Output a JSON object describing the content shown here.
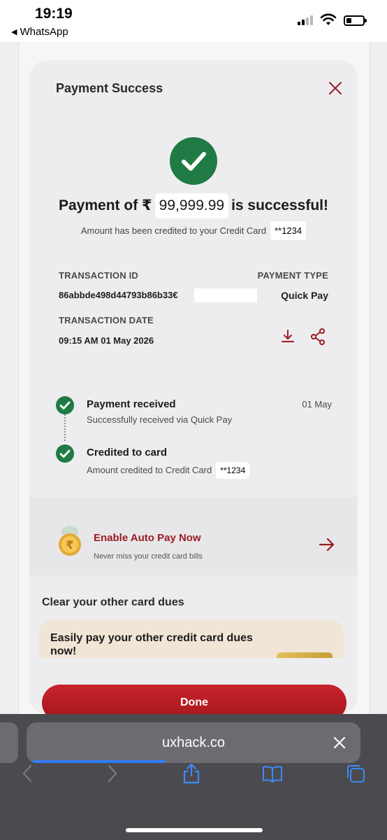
{
  "status_bar": {
    "time": "19:19",
    "back_app": "WhatsApp"
  },
  "modal": {
    "title": "Payment Success",
    "headline_prefix": "Payment of ₹",
    "amount": "99,999.99",
    "headline_suffix": "is successful!",
    "credited_text": "Amount has been credited to your Credit Card",
    "card_masked": "**1234",
    "transaction": {
      "id_label": "TRANSACTION ID",
      "id_value": "86abbde498d44793b86b33€",
      "type_label": "PAYMENT TYPE",
      "type_value": "Quick Pay",
      "date_label": "TRANSACTION DATE",
      "date_value": "09:15 AM 01 May 2026"
    },
    "timeline": [
      {
        "title": "Payment received",
        "subtitle": "Successfully received via Quick Pay",
        "date": "01 May"
      },
      {
        "title": "Credited to card",
        "subtitle": "Amount credited to Credit Card",
        "card": "**1234"
      }
    ],
    "autopay": {
      "title": "Enable Auto Pay Now",
      "subtitle": "Never miss your credit card bills"
    },
    "other_dues": {
      "section_title": "Clear your other card dues",
      "promo_text": "Easily pay your other credit card dues now!"
    },
    "done_label": "Done"
  },
  "browser": {
    "url": "uxhack.co",
    "load_progress": 0.4
  },
  "colors": {
    "success_green": "#1f7a44",
    "brand_red": "#b41c23",
    "safari_bar": "#4b4b4f",
    "progress_blue": "#2f7cf6"
  },
  "icons": [
    "signal-icon",
    "wifi-icon",
    "battery-icon",
    "close-icon",
    "check-icon",
    "download-icon",
    "share-icon",
    "rupee-coin-icon",
    "arrow-right-icon",
    "back-icon",
    "forward-icon",
    "share-sheet-icon",
    "bookmarks-icon",
    "tabs-icon"
  ]
}
